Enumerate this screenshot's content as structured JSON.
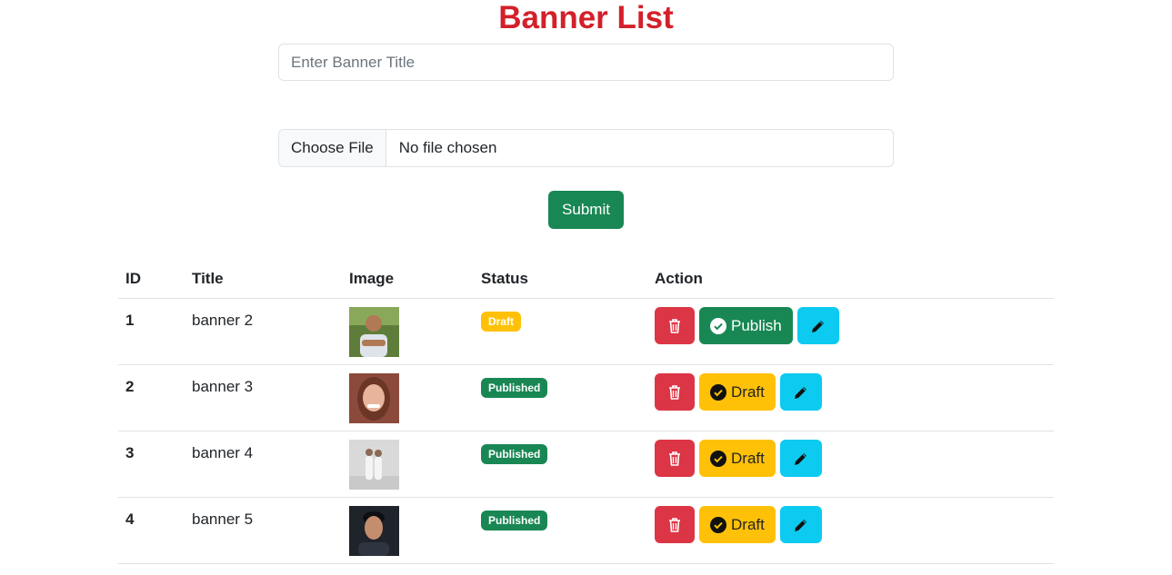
{
  "page": {
    "title": "Banner List"
  },
  "form": {
    "title_placeholder": "Enter Banner Title",
    "title_value": "",
    "file_button_label": "Choose File",
    "file_status": "No file chosen",
    "submit_label": "Submit"
  },
  "table": {
    "headers": [
      "ID",
      "Title",
      "Image",
      "Status",
      "Action"
    ],
    "rows": [
      {
        "id": "1",
        "title": "banner 2",
        "status": "Draft",
        "toggle_label": "Publish"
      },
      {
        "id": "2",
        "title": "banner 3",
        "status": "Published",
        "toggle_label": "Draft"
      },
      {
        "id": "3",
        "title": "banner 4",
        "status": "Published",
        "toggle_label": "Draft"
      },
      {
        "id": "4",
        "title": "banner 5",
        "status": "Published",
        "toggle_label": "Draft"
      }
    ]
  },
  "colors": {
    "title": "#d3202a",
    "success": "#198754",
    "warning": "#ffc107",
    "danger": "#dc3545",
    "info": "#0dcaf0"
  },
  "icons": {
    "delete": "trash-icon",
    "publish": "check-circle-icon",
    "draft": "check-circle-icon",
    "edit": "pencil-icon"
  }
}
